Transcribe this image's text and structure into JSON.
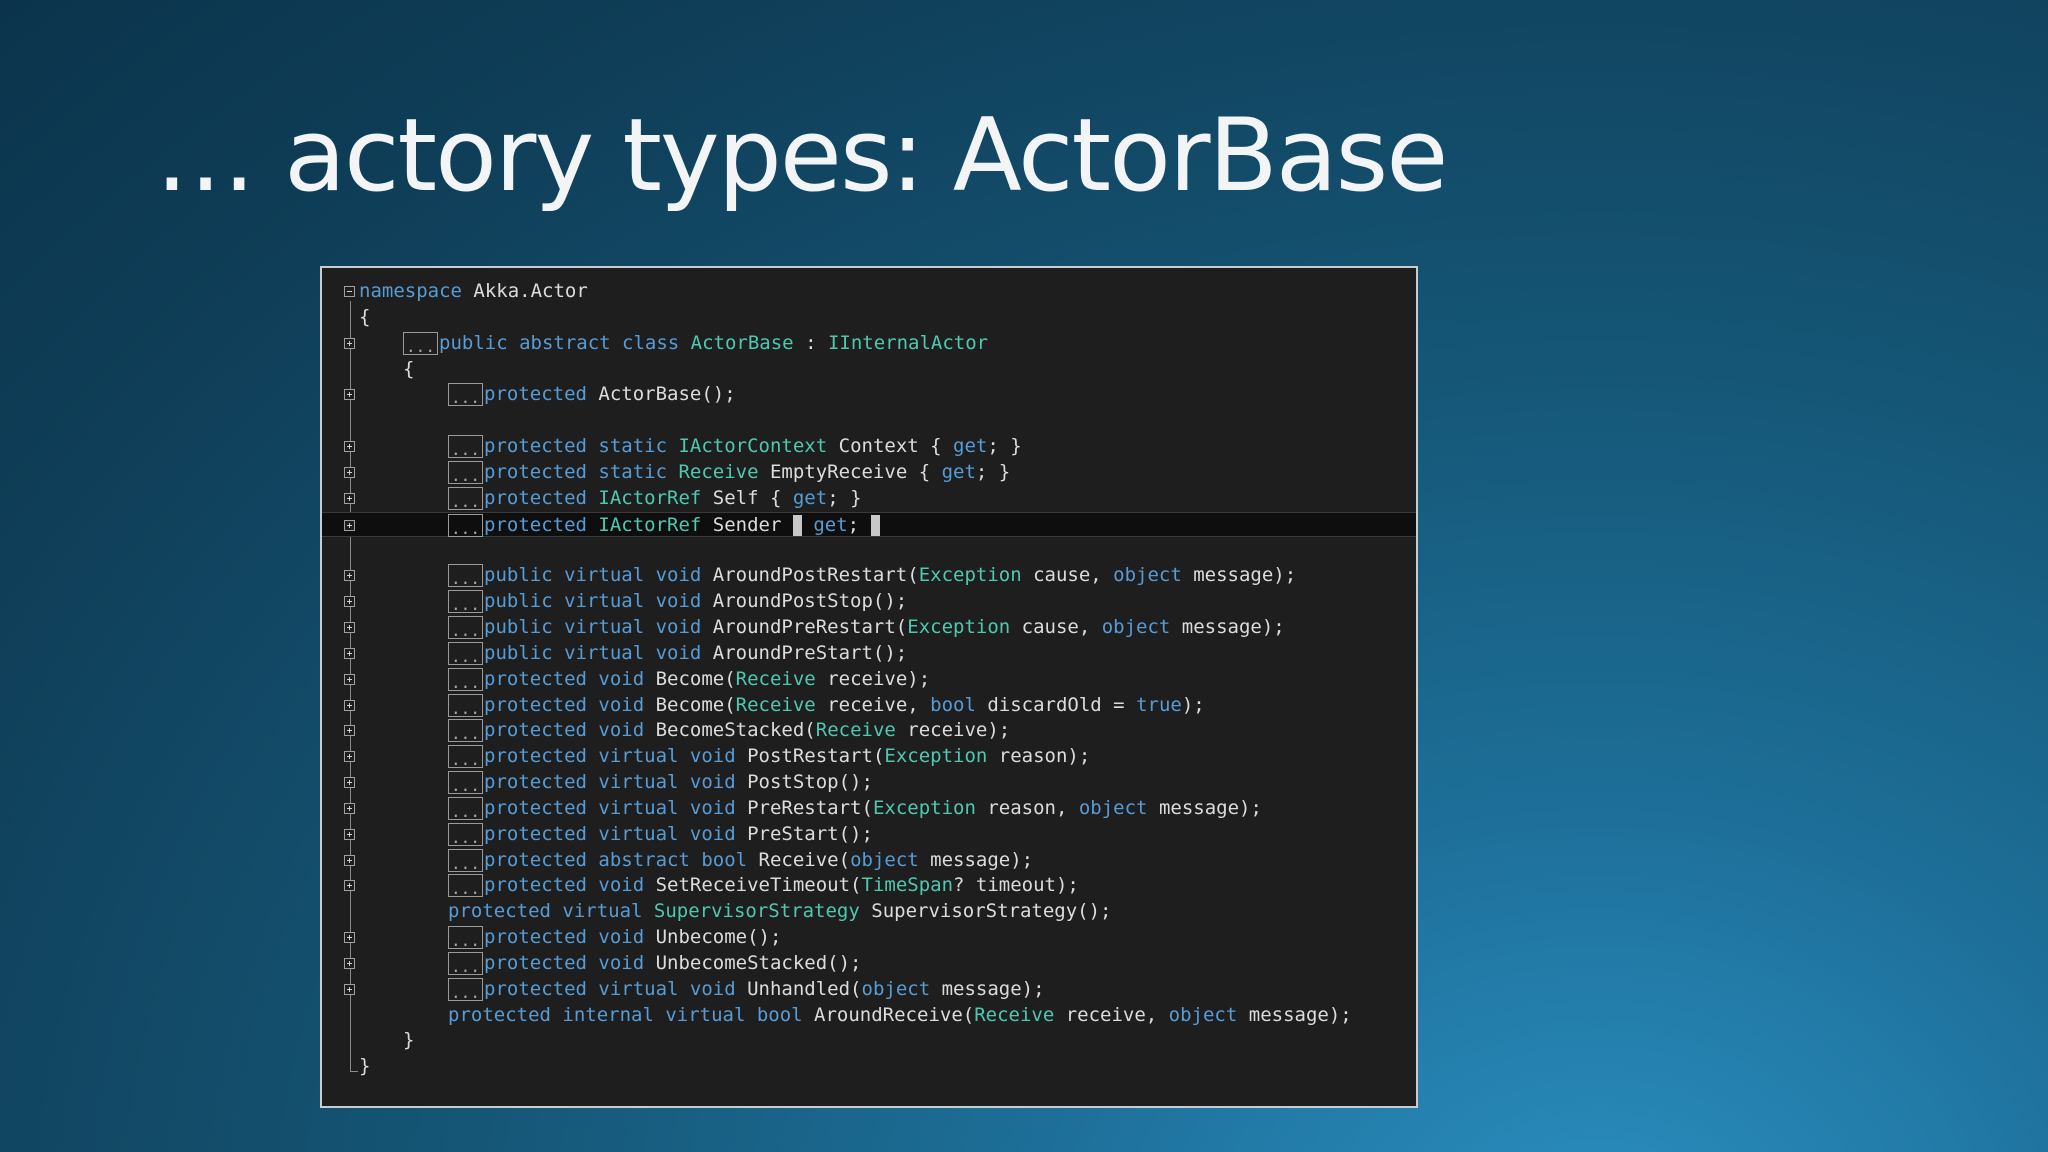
{
  "slide": {
    "title": "… actory types: ActorBase"
  },
  "editor": {
    "collapsed_marker": "...",
    "colors": {
      "background": "#1e1e1e",
      "keyword": "#569cd6",
      "type": "#4ec9b0",
      "text": "#dcdcdc",
      "frame_border": "#c8cccf"
    },
    "lines": [
      {
        "fold": "minus",
        "indent": 0,
        "collapsed": false,
        "segs": [
          {
            "t": "namespace",
            "c": "kw"
          },
          {
            "t": " Akka.Actor",
            "c": "tx"
          }
        ]
      },
      {
        "fold": "none",
        "indent": 0,
        "collapsed": false,
        "segs": [
          {
            "t": "{",
            "c": "tx"
          }
        ]
      },
      {
        "fold": "plus",
        "indent": 1,
        "collapsed": true,
        "segs": [
          {
            "t": "public abstract class ",
            "c": "kw"
          },
          {
            "t": "ActorBase",
            "c": "ty"
          },
          {
            "t": " : ",
            "c": "tx"
          },
          {
            "t": "IInternalActor",
            "c": "ty"
          }
        ]
      },
      {
        "fold": "none",
        "indent": 1,
        "collapsed": false,
        "segs": [
          {
            "t": "{",
            "c": "tx"
          }
        ]
      },
      {
        "fold": "plus",
        "indent": 2,
        "collapsed": true,
        "segs": [
          {
            "t": "protected",
            "c": "kw"
          },
          {
            "t": " ActorBase();",
            "c": "tx"
          }
        ]
      },
      {
        "fold": "none",
        "indent": 0,
        "collapsed": false,
        "segs": []
      },
      {
        "fold": "plus",
        "indent": 2,
        "collapsed": true,
        "segs": [
          {
            "t": "protected static ",
            "c": "kw"
          },
          {
            "t": "IActorContext",
            "c": "ty"
          },
          {
            "t": " Context { ",
            "c": "tx"
          },
          {
            "t": "get",
            "c": "kw"
          },
          {
            "t": "; }",
            "c": "tx"
          }
        ]
      },
      {
        "fold": "plus",
        "indent": 2,
        "collapsed": true,
        "segs": [
          {
            "t": "protected static ",
            "c": "kw"
          },
          {
            "t": "Receive",
            "c": "ty"
          },
          {
            "t": " EmptyReceive { ",
            "c": "tx"
          },
          {
            "t": "get",
            "c": "kw"
          },
          {
            "t": "; }",
            "c": "tx"
          }
        ]
      },
      {
        "fold": "plus",
        "indent": 2,
        "collapsed": true,
        "segs": [
          {
            "t": "protected ",
            "c": "kw"
          },
          {
            "t": "IActorRef",
            "c": "ty"
          },
          {
            "t": " Self { ",
            "c": "tx"
          },
          {
            "t": "get",
            "c": "kw"
          },
          {
            "t": "; }",
            "c": "tx"
          }
        ]
      },
      {
        "fold": "plus",
        "indent": 2,
        "collapsed": true,
        "current": true,
        "segs": [
          {
            "t": "protected ",
            "c": "kw"
          },
          {
            "t": "IActorRef",
            "c": "ty"
          },
          {
            "t": " Sender ",
            "c": "tx"
          },
          {
            "t": "",
            "c": "caret"
          },
          {
            "t": " ",
            "c": "tx"
          },
          {
            "t": "get",
            "c": "kw"
          },
          {
            "t": "; ",
            "c": "tx"
          },
          {
            "t": "",
            "c": "caret"
          }
        ]
      },
      {
        "fold": "none",
        "indent": 0,
        "collapsed": false,
        "segs": []
      },
      {
        "fold": "plus",
        "indent": 2,
        "collapsed": true,
        "segs": [
          {
            "t": "public virtual void",
            "c": "kw"
          },
          {
            "t": " AroundPostRestart(",
            "c": "tx"
          },
          {
            "t": "Exception",
            "c": "ty"
          },
          {
            "t": " cause, ",
            "c": "tx"
          },
          {
            "t": "object",
            "c": "kw"
          },
          {
            "t": " message);",
            "c": "tx"
          }
        ]
      },
      {
        "fold": "plus",
        "indent": 2,
        "collapsed": true,
        "segs": [
          {
            "t": "public virtual void",
            "c": "kw"
          },
          {
            "t": " AroundPostStop();",
            "c": "tx"
          }
        ]
      },
      {
        "fold": "plus",
        "indent": 2,
        "collapsed": true,
        "segs": [
          {
            "t": "public virtual void",
            "c": "kw"
          },
          {
            "t": " AroundPreRestart(",
            "c": "tx"
          },
          {
            "t": "Exception",
            "c": "ty"
          },
          {
            "t": " cause, ",
            "c": "tx"
          },
          {
            "t": "object",
            "c": "kw"
          },
          {
            "t": " message);",
            "c": "tx"
          }
        ]
      },
      {
        "fold": "plus",
        "indent": 2,
        "collapsed": true,
        "segs": [
          {
            "t": "public virtual void",
            "c": "kw"
          },
          {
            "t": " AroundPreStart();",
            "c": "tx"
          }
        ]
      },
      {
        "fold": "plus",
        "indent": 2,
        "collapsed": true,
        "segs": [
          {
            "t": "protected void",
            "c": "kw"
          },
          {
            "t": " Become(",
            "c": "tx"
          },
          {
            "t": "Receive",
            "c": "ty"
          },
          {
            "t": " receive);",
            "c": "tx"
          }
        ]
      },
      {
        "fold": "plus",
        "indent": 2,
        "collapsed": true,
        "segs": [
          {
            "t": "protected void",
            "c": "kw"
          },
          {
            "t": " Become(",
            "c": "tx"
          },
          {
            "t": "Receive",
            "c": "ty"
          },
          {
            "t": " receive, ",
            "c": "tx"
          },
          {
            "t": "bool",
            "c": "kw"
          },
          {
            "t": " discardOld = ",
            "c": "tx"
          },
          {
            "t": "true",
            "c": "kw"
          },
          {
            "t": ");",
            "c": "tx"
          }
        ]
      },
      {
        "fold": "plus",
        "indent": 2,
        "collapsed": true,
        "segs": [
          {
            "t": "protected void",
            "c": "kw"
          },
          {
            "t": " BecomeStacked(",
            "c": "tx"
          },
          {
            "t": "Receive",
            "c": "ty"
          },
          {
            "t": " receive);",
            "c": "tx"
          }
        ]
      },
      {
        "fold": "plus",
        "indent": 2,
        "collapsed": true,
        "segs": [
          {
            "t": "protected virtual void",
            "c": "kw"
          },
          {
            "t": " PostRestart(",
            "c": "tx"
          },
          {
            "t": "Exception",
            "c": "ty"
          },
          {
            "t": " reason);",
            "c": "tx"
          }
        ]
      },
      {
        "fold": "plus",
        "indent": 2,
        "collapsed": true,
        "segs": [
          {
            "t": "protected virtual void",
            "c": "kw"
          },
          {
            "t": " PostStop();",
            "c": "tx"
          }
        ]
      },
      {
        "fold": "plus",
        "indent": 2,
        "collapsed": true,
        "segs": [
          {
            "t": "protected virtual void",
            "c": "kw"
          },
          {
            "t": " PreRestart(",
            "c": "tx"
          },
          {
            "t": "Exception",
            "c": "ty"
          },
          {
            "t": " reason, ",
            "c": "tx"
          },
          {
            "t": "object",
            "c": "kw"
          },
          {
            "t": " message);",
            "c": "tx"
          }
        ]
      },
      {
        "fold": "plus",
        "indent": 2,
        "collapsed": true,
        "segs": [
          {
            "t": "protected virtual void",
            "c": "kw"
          },
          {
            "t": " PreStart();",
            "c": "tx"
          }
        ]
      },
      {
        "fold": "plus",
        "indent": 2,
        "collapsed": true,
        "segs": [
          {
            "t": "protected abstract bool",
            "c": "kw"
          },
          {
            "t": " Receive(",
            "c": "tx"
          },
          {
            "t": "object",
            "c": "kw"
          },
          {
            "t": " message);",
            "c": "tx"
          }
        ]
      },
      {
        "fold": "plus",
        "indent": 2,
        "collapsed": true,
        "segs": [
          {
            "t": "protected void",
            "c": "kw"
          },
          {
            "t": " SetReceiveTimeout(",
            "c": "tx"
          },
          {
            "t": "TimeSpan",
            "c": "ty"
          },
          {
            "t": "? timeout);",
            "c": "tx"
          }
        ]
      },
      {
        "fold": "none",
        "indent": 2,
        "collapsed": false,
        "segs": [
          {
            "t": "protected virtual ",
            "c": "kw"
          },
          {
            "t": "SupervisorStrategy",
            "c": "ty"
          },
          {
            "t": " SupervisorStrategy();",
            "c": "tx"
          }
        ]
      },
      {
        "fold": "plus",
        "indent": 2,
        "collapsed": true,
        "segs": [
          {
            "t": "protected void",
            "c": "kw"
          },
          {
            "t": " Unbecome();",
            "c": "tx"
          }
        ]
      },
      {
        "fold": "plus",
        "indent": 2,
        "collapsed": true,
        "segs": [
          {
            "t": "protected void",
            "c": "kw"
          },
          {
            "t": " UnbecomeStacked();",
            "c": "tx"
          }
        ]
      },
      {
        "fold": "plus",
        "indent": 2,
        "collapsed": true,
        "segs": [
          {
            "t": "protected virtual void",
            "c": "kw"
          },
          {
            "t": " Unhandled(",
            "c": "tx"
          },
          {
            "t": "object",
            "c": "kw"
          },
          {
            "t": " message);",
            "c": "tx"
          }
        ]
      },
      {
        "fold": "none",
        "indent": 2,
        "collapsed": false,
        "segs": [
          {
            "t": "protected internal virtual bool",
            "c": "kw"
          },
          {
            "t": " AroundReceive(",
            "c": "tx"
          },
          {
            "t": "Receive",
            "c": "ty"
          },
          {
            "t": " receive, ",
            "c": "tx"
          },
          {
            "t": "object",
            "c": "kw"
          },
          {
            "t": " message);",
            "c": "tx"
          }
        ]
      },
      {
        "fold": "none",
        "indent": 1,
        "collapsed": false,
        "segs": [
          {
            "t": "}",
            "c": "tx"
          }
        ]
      },
      {
        "fold": "none",
        "indent": 0,
        "collapsed": false,
        "segs": [
          {
            "t": "}",
            "c": "tx"
          }
        ]
      }
    ]
  }
}
